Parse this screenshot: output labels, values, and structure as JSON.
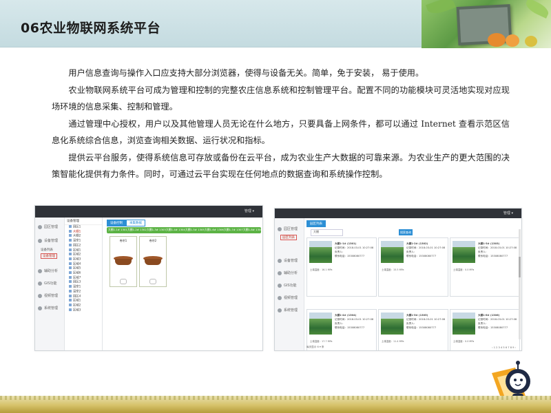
{
  "slide": {
    "title": "06农业物联网系统平台",
    "paragraphs": [
      "用户信息查询与操作入口应支持大部分浏览器，使得与设备无关。简单，免于安装，  易于使用。",
      "农业物联网系统平台可成为管理和控制的完整农庄信息系统和控制管理平台。配置不同的功能模块可灵活地实现对应现场环境的信息采集、控制和管理。",
      "通过管理中心授权，用户以及其他管理人员无论在什么地方，只要具备上网条件，都可以通过 Internet 查看示范区信息化系统综合信息，浏览查询相关数据、运行状况和指标。",
      "提供云平台服务，使得系统信息可存放或备份在云平台，成为农业生产大数据的可靠来源。为农业生产的更大范围的决策智能化提供有力条件。同时，可通过云平台实现在任何地点的数据查询和系统操作控制。"
    ]
  },
  "shot_left": {
    "user": "管理 ▾",
    "sidebar": [
      "园区管理",
      "设备管理",
      "设备列表",
      "设备管理",
      "辅助分析",
      "GIS功能",
      "视频管理",
      "系统管理"
    ],
    "tree_head": "设备管理",
    "tree_items": [
      "园区1",
      "大棚1",
      "大棚2",
      "温室1",
      "园区2",
      "区域1",
      "区域2",
      "区域3",
      "区域4",
      "区域5",
      "区域6",
      "区域7",
      "园区3",
      "温室1",
      "温室2",
      "园区4",
      "区域1",
      "区域2",
      "区域3"
    ],
    "tabs": [
      "设备控制",
      "采集数据"
    ],
    "green_segments": [
      "大棚1-1# 1301",
      "大棚1-2# 1302",
      "大棚1-3# 1303",
      "大棚1-4# 1304",
      "大棚1-5# 1305",
      "大棚1-6# 1306",
      "大棚1-7# 1307",
      "大棚1-8# 1308"
    ],
    "devices": [
      "卷帘1",
      "卷帘2"
    ]
  },
  "shot_right": {
    "user": "管理 ▾",
    "sidebar": [
      "园区管理",
      "园区列表",
      "设备管理",
      "辅助分析",
      "GIS功能",
      "视频管理",
      "系统管理"
    ],
    "top_tab": "园区列表",
    "search_value": "大棚",
    "search_button": "搜索查询",
    "cards": [
      {
        "name": "大棚1-1# (1301)",
        "time": "记录时间：2018-03-01 10:27:08",
        "owner": "负责人：",
        "phone": "联系电话：15308080777",
        "value": "土壤温度：16.1 MPa"
      },
      {
        "name": "大棚1-2# (1302)",
        "time": "记录时间：2018-03-01 10:27:08",
        "owner": "负责人：",
        "phone": "联系电话：15308080777",
        "value": "土壤温度：15.5 MPa"
      },
      {
        "name": "大棚1-3# (1303)",
        "time": "记录时间：2018-03-01 10:27:08",
        "owner": "负责人：",
        "phone": "联系电话：15308080777",
        "value": "土壤温度：0.0 MPa"
      },
      {
        "name": "大棚1-4# (1304)",
        "time": "记录时间：2018-03-01 10:27:08",
        "owner": "负责人：",
        "phone": "联系电话：15308080777",
        "value": "土壤温度：17.7 MPa"
      },
      {
        "name": "大棚1-5# (1305)",
        "time": "记录时间：2018-03-01 10:27:08",
        "owner": "负责人：",
        "phone": "联系电话：15308080777",
        "value": "土壤温度：11.4 MPa"
      },
      {
        "name": "大棚1-6# (1306)",
        "time": "记录时间：2018-03-01 10:27:08",
        "owner": "负责人：",
        "phone": "联系电话：15308080777",
        "value": "土壤温度：0.0 MPa"
      }
    ],
    "footer_left": "每页显示 6 ▾ 条",
    "pager": "‹ 1 2 3 4 5 6 7 8 9 ›"
  }
}
